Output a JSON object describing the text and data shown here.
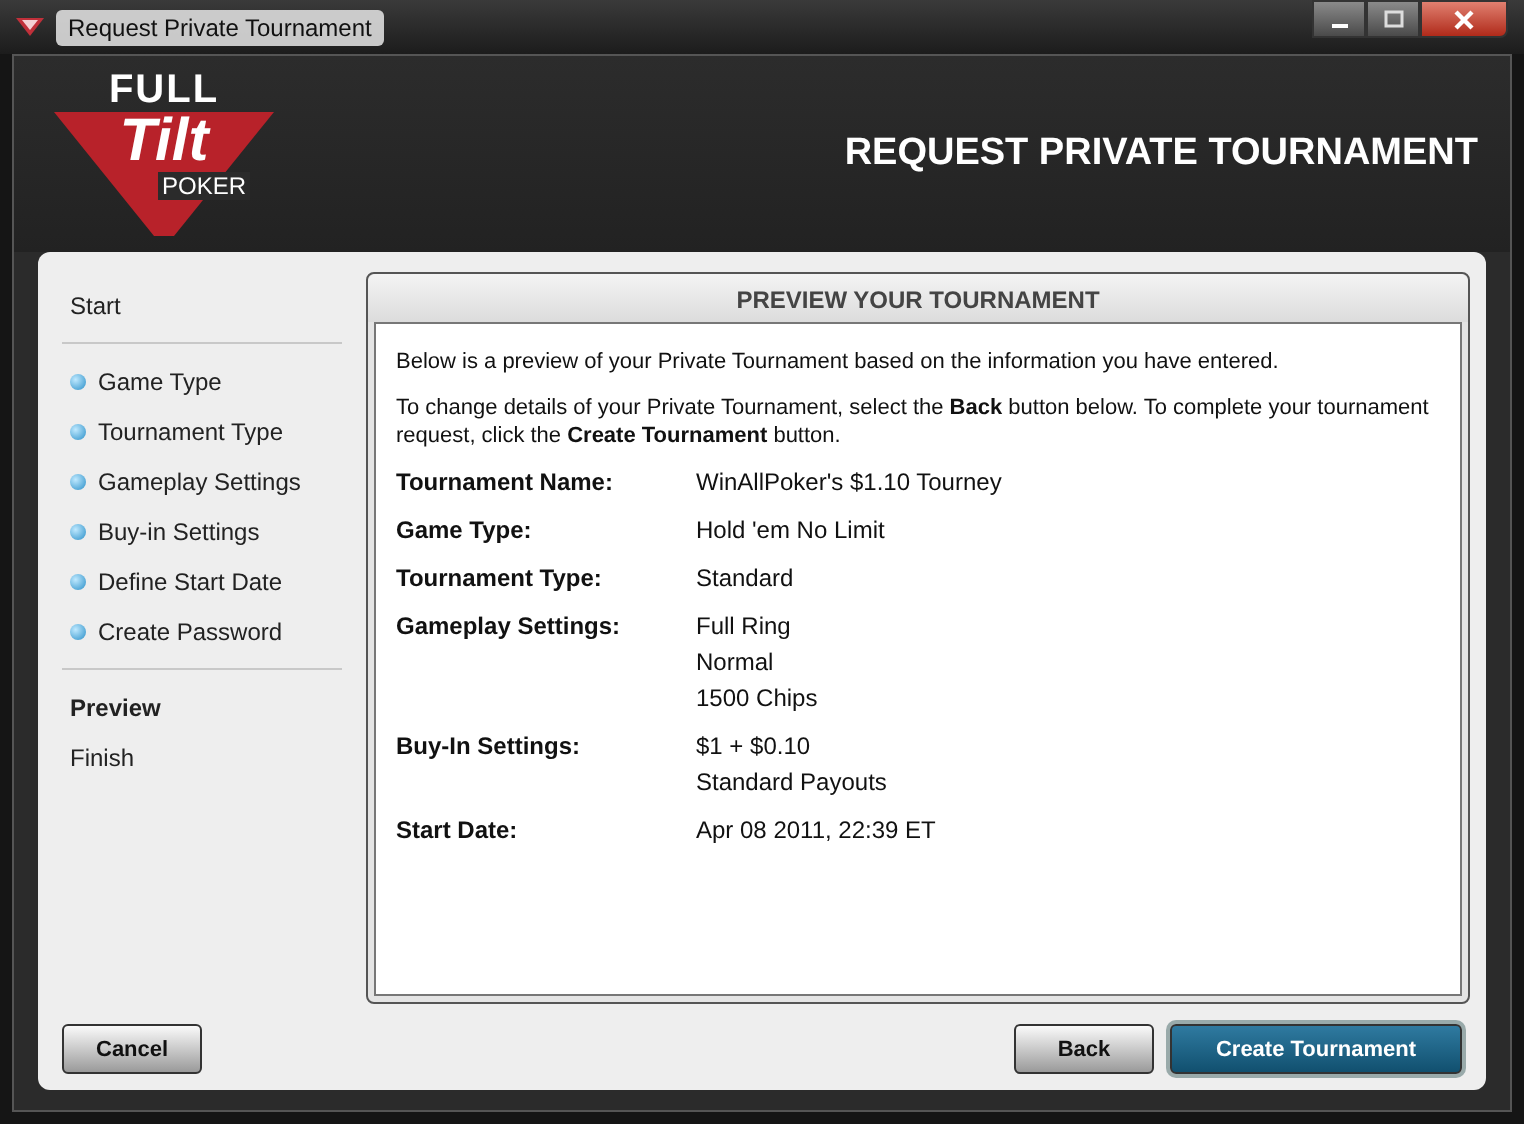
{
  "window": {
    "title": "Request Private Tournament"
  },
  "logo": {
    "top": "FULL",
    "middle": "Tilt",
    "bottom": "POKER"
  },
  "header": {
    "title": "REQUEST PRIVATE TOURNAMENT"
  },
  "sidebar": {
    "groups": [
      [
        {
          "label": "Start",
          "kind": "plain",
          "selected": false
        }
      ],
      [
        {
          "label": "Game Type",
          "kind": "step",
          "selected": false
        },
        {
          "label": "Tournament Type",
          "kind": "step",
          "selected": false
        },
        {
          "label": "Gameplay Settings",
          "kind": "step",
          "selected": false
        },
        {
          "label": "Buy-in Settings",
          "kind": "step",
          "selected": false
        },
        {
          "label": "Define Start Date",
          "kind": "step",
          "selected": false
        },
        {
          "label": "Create Password",
          "kind": "step",
          "selected": false
        }
      ],
      [
        {
          "label": "Preview",
          "kind": "plain",
          "selected": true
        },
        {
          "label": "Finish",
          "kind": "plain",
          "selected": false
        }
      ]
    ]
  },
  "preview": {
    "title": "PREVIEW YOUR TOURNAMENT",
    "intro": [
      "Below is a preview of your Private Tournament based on the information you have entered.",
      "To change details of your Private Tournament, select the **Back** button below. To complete your tournament request, click the **Create Tournament** button."
    ],
    "details": [
      {
        "label": "Tournament Name:",
        "values": [
          "WinAllPoker's $1.10 Tourney"
        ]
      },
      {
        "label": "Game Type:",
        "values": [
          "Hold 'em No Limit"
        ]
      },
      {
        "label": "Tournament Type:",
        "values": [
          "Standard"
        ]
      },
      {
        "label": "Gameplay Settings:",
        "values": [
          "Full Ring",
          "Normal",
          "1500 Chips"
        ]
      },
      {
        "label": "Buy-In Settings:",
        "values": [
          "$1 + $0.10",
          "Standard Payouts"
        ]
      },
      {
        "label": "Start Date:",
        "values": [
          "Apr 08 2011, 22:39 ET"
        ]
      }
    ]
  },
  "buttons": {
    "cancel": "Cancel",
    "back": "Back",
    "create": "Create Tournament"
  }
}
